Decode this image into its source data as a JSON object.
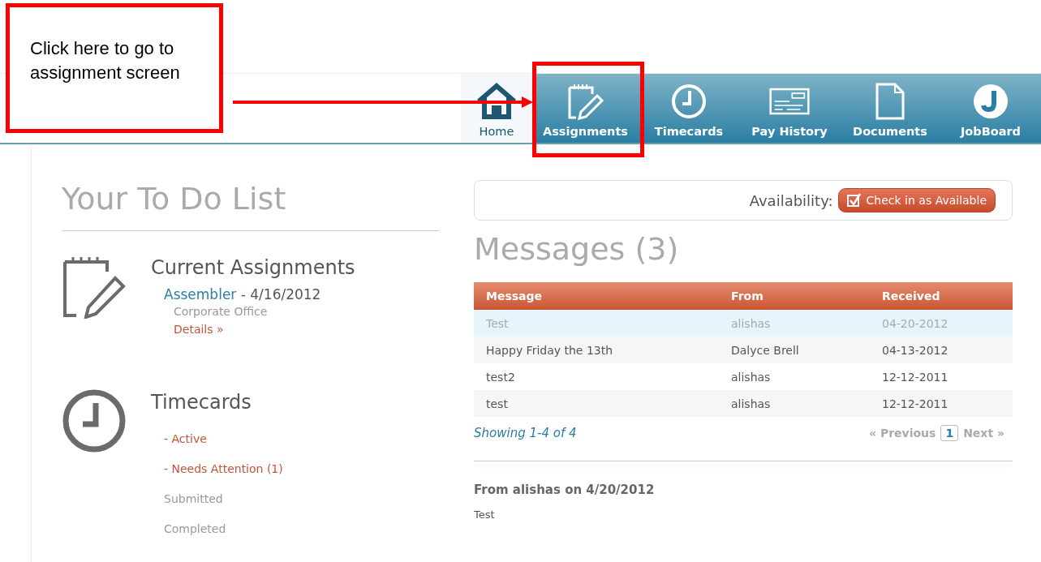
{
  "callout": {
    "text": "Click here to go to assignment screen"
  },
  "nav": [
    {
      "label": "Home",
      "kind": "house",
      "selected": true
    },
    {
      "label": "Assignments",
      "kind": "notepad",
      "selected": false
    },
    {
      "label": "Timecards",
      "kind": "clock",
      "selected": false
    },
    {
      "label": "Pay History",
      "kind": "check",
      "selected": false
    },
    {
      "label": "Documents",
      "kind": "document",
      "selected": false
    },
    {
      "label": "JobBoard",
      "kind": "logo",
      "selected": false
    }
  ],
  "todo": {
    "title": "Your To Do List",
    "assignments": {
      "heading": "Current Assignments",
      "job": "Assembler",
      "date": " - 4/16/2012",
      "location": "Corporate Office",
      "details": "Details »"
    },
    "timecards": {
      "heading": "Timecards",
      "items": [
        {
          "label": "- Active",
          "kind": "link"
        },
        {
          "label": "- Needs Attention (1)",
          "kind": "link"
        },
        {
          "label": "Submitted",
          "kind": "plain"
        },
        {
          "label": "Completed",
          "kind": "plain"
        }
      ]
    }
  },
  "availability": {
    "label": "Availability:",
    "button": "Check in as Available"
  },
  "messages": {
    "title": "Messages (3)",
    "columns": [
      "Message",
      "From",
      "Received"
    ],
    "rows": [
      {
        "cells": [
          "Test",
          "alishas",
          "04-20-2012"
        ],
        "selected": true
      },
      {
        "cells": [
          "Happy Friday the 13th",
          "Dalyce Brell",
          "04-13-2012"
        ],
        "selected": false
      },
      {
        "cells": [
          "test2",
          "alishas",
          "12-12-2011"
        ],
        "selected": false
      },
      {
        "cells": [
          "test",
          "alishas",
          "12-12-2011"
        ],
        "selected": false
      }
    ],
    "showing": "Showing 1-4 of 4",
    "previous": "« Previous",
    "page": "1",
    "next": "Next »"
  },
  "detail": {
    "heading": "From alishas on 4/20/2012",
    "body": "Test"
  }
}
